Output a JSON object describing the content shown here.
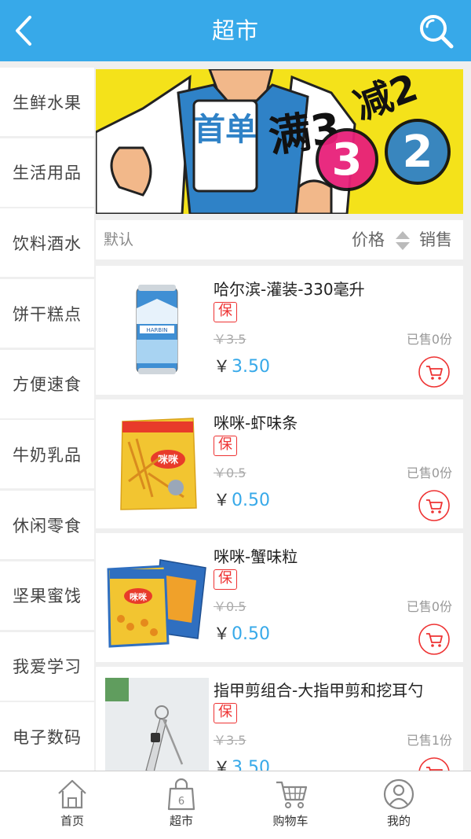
{
  "header": {
    "title": "超市",
    "back_icon": "chevron-left-icon",
    "search_icon": "search-icon"
  },
  "colors": {
    "accent": "#37a9e9",
    "badge_red": "#e33333",
    "banner_yellow": "#f4e21a"
  },
  "sidebar": {
    "items": [
      {
        "label": "生鲜水果"
      },
      {
        "label": "生活用品"
      },
      {
        "label": "饮料酒水"
      },
      {
        "label": "饼干糕点"
      },
      {
        "label": "方便速食"
      },
      {
        "label": "牛奶乳品"
      },
      {
        "label": "休闲零食"
      },
      {
        "label": "坚果蜜饯"
      },
      {
        "label": "我爱学习"
      },
      {
        "label": "电子数码"
      }
    ]
  },
  "banner": {
    "shirt_text": "首单",
    "promo_text_1": "满3",
    "promo_text_2": "减2"
  },
  "sortbar": {
    "default_label": "默认",
    "price_label": "价格",
    "sales_label": "销售"
  },
  "products": [
    {
      "name": "哈尔滨-灌装-330毫升",
      "badge": "保",
      "old_price": "￥3.5",
      "sold": "已售0份",
      "currency": "￥",
      "price": "3.50",
      "image": "beer-can-image"
    },
    {
      "name": "咪咪-虾味条",
      "badge": "保",
      "old_price": "￥0.5",
      "sold": "已售0份",
      "currency": "￥",
      "price": "0.50",
      "image": "snack-bag-image"
    },
    {
      "name": "咪咪-蟹味粒",
      "badge": "保",
      "old_price": "￥0.5",
      "sold": "已售0份",
      "currency": "￥",
      "price": "0.50",
      "image": "snack-bags-image"
    },
    {
      "name": "指甲剪组合-大指甲剪和挖耳勺",
      "badge": "保",
      "old_price": "￥3.5",
      "sold": "已售1份",
      "currency": "￥",
      "price": "3.50",
      "image": "nail-clipper-image"
    }
  ],
  "tabbar": {
    "items": [
      {
        "label": "首页",
        "icon": "home-icon"
      },
      {
        "label": "超市",
        "icon": "shopping-bag-icon",
        "bag_number": "6"
      },
      {
        "label": "购物车",
        "icon": "cart-icon"
      },
      {
        "label": "我的",
        "icon": "user-icon"
      }
    ]
  }
}
